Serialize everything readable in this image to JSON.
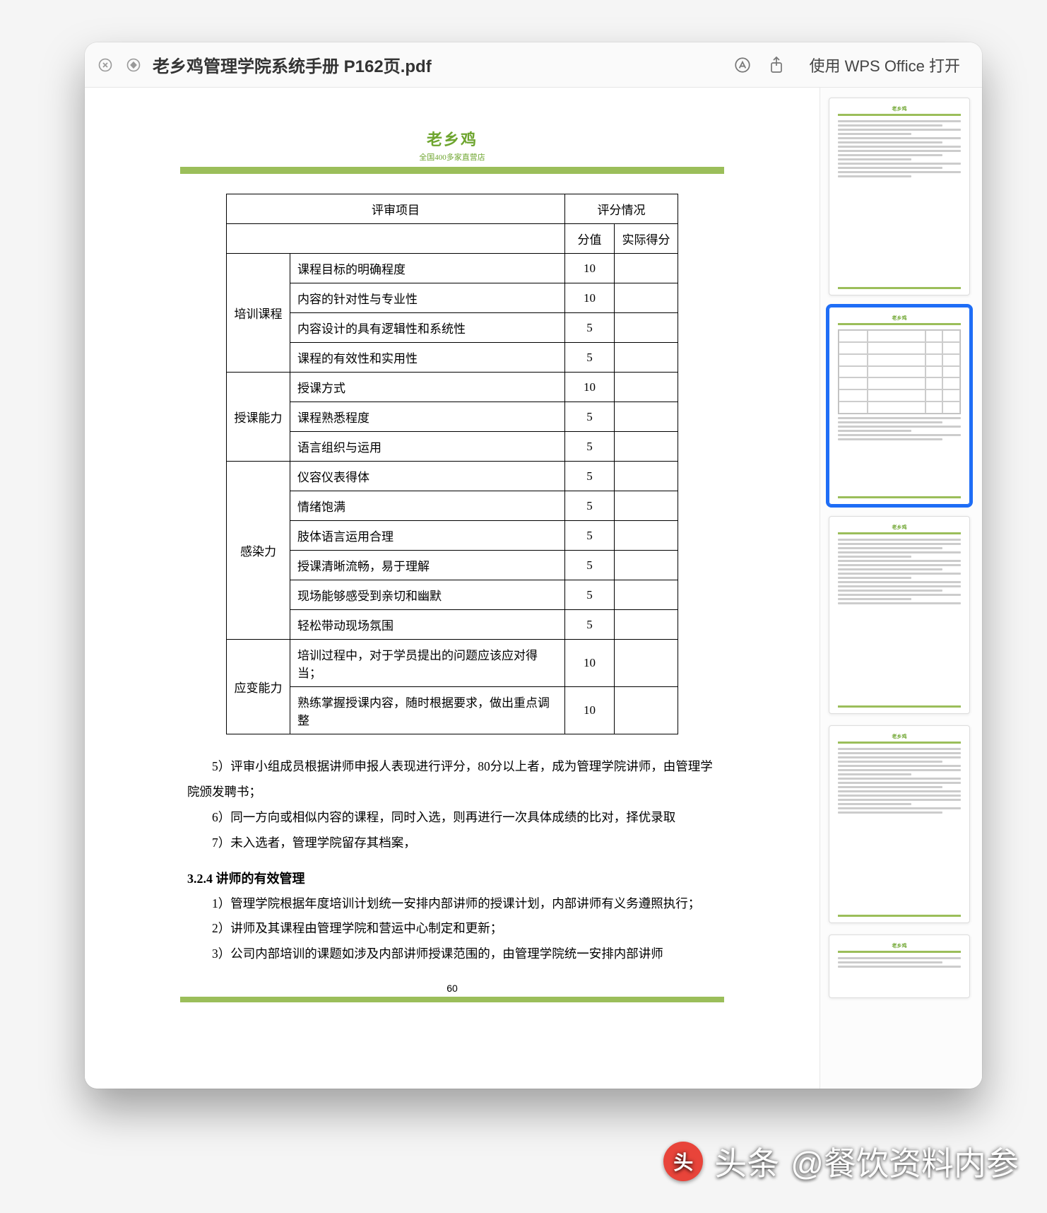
{
  "window": {
    "title": "老乡鸡管理学院系统手册 P162页.pdf",
    "open_with_label": "使用 WPS Office 打开"
  },
  "doc_header": {
    "brand": "老乡鸡",
    "tagline": "全国400多家直营店"
  },
  "table": {
    "col_project": "评审项目",
    "col_scoring": "评分情况",
    "col_score": "分值",
    "col_actual": "实际得分",
    "groups": [
      {
        "name": "培训课程",
        "rows": [
          {
            "item": "课程目标的明确程度",
            "score": "10"
          },
          {
            "item": "内容的针对性与专业性",
            "score": "10"
          },
          {
            "item": "内容设计的具有逻辑性和系统性",
            "score": "5"
          },
          {
            "item": "课程的有效性和实用性",
            "score": "5"
          }
        ]
      },
      {
        "name": "授课能力",
        "rows": [
          {
            "item": "授课方式",
            "score": "10"
          },
          {
            "item": "课程熟悉程度",
            "score": "5"
          },
          {
            "item": "语言组织与运用",
            "score": "5"
          }
        ]
      },
      {
        "name": "感染力",
        "rows": [
          {
            "item": "仪容仪表得体",
            "score": "5"
          },
          {
            "item": "情绪饱满",
            "score": "5"
          },
          {
            "item": "肢体语言运用合理",
            "score": "5"
          },
          {
            "item": "授课清晰流畅，易于理解",
            "score": "5"
          },
          {
            "item": "现场能够感受到亲切和幽默",
            "score": "5"
          },
          {
            "item": "轻松带动现场氛围",
            "score": "5"
          }
        ]
      },
      {
        "name": "应变能力",
        "rows": [
          {
            "item": "培训过程中，对于学员提出的问题应该应对得当；",
            "score": "10"
          },
          {
            "item": "熟练掌握授课内容，随时根据要求，做出重点调整",
            "score": "10"
          }
        ]
      }
    ]
  },
  "paragraphs": {
    "p5": "5）评审小组成员根据讲师申报人表现进行评分，80分以上者，成为管理学院讲师，由管理学院颁发聘书；",
    "p6": "6）同一方向或相似内容的课程，同时入选，则再进行一次具体成绩的比对，择优录取",
    "p7": "7）未入选者，管理学院留存其档案，",
    "heading": "3.2.4  讲师的有效管理",
    "l1": "1）管理学院根据年度培训计划统一安排内部讲师的授课计划，内部讲师有义务遵照执行；",
    "l2": "2）讲师及其课程由管理学院和营运中心制定和更新；",
    "l3": "3）公司内部培训的课题如涉及内部讲师授课范围的，由管理学院统一安排内部讲师"
  },
  "page_number": "60",
  "watermark": {
    "brand": "头条",
    "author": "@餐饮资料内参"
  }
}
